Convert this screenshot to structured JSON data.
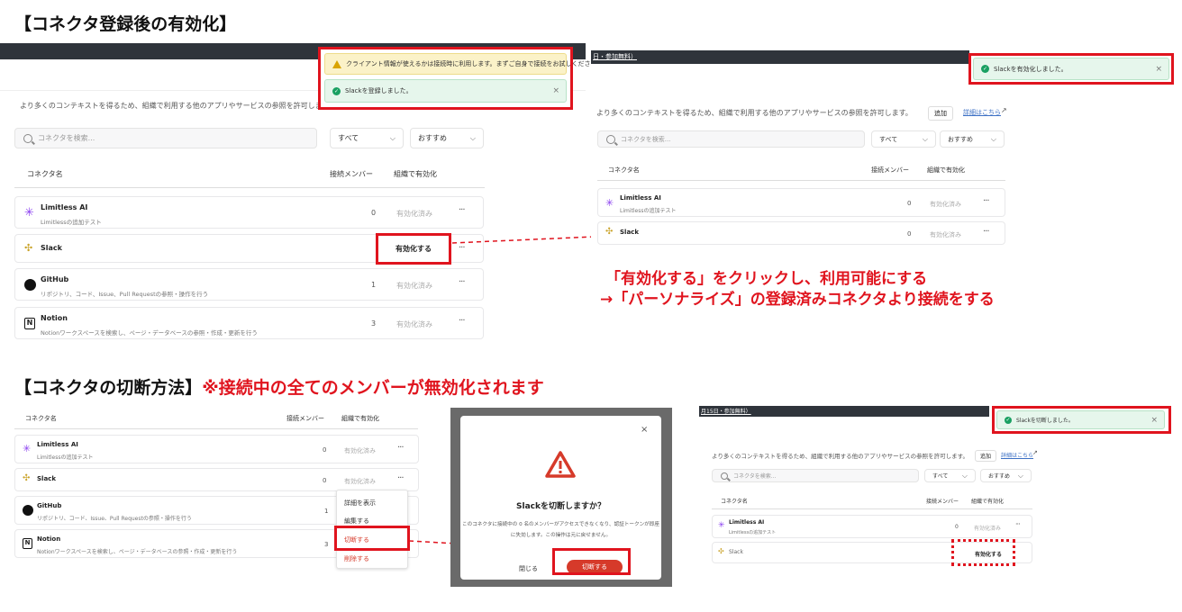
{
  "titles": {
    "section1": "【コネクタ登録後の有効化】",
    "section2_main": "【コネクタの切断方法】",
    "section2_warn": "※接続中の全てのメンバーが無効化されます"
  },
  "annotation": {
    "line1": "「有効化する」をクリックし、利用可能にする",
    "line2": "→「パーソナライズ」の登録済みコネクタより接続をする"
  },
  "common": {
    "description": "より多くのコンテキストを得るため、組織で利用する他のアプリやサービスの参照を許可します。",
    "search_placeholder": "コネクタを検索...",
    "filter_all": "すべて",
    "filter_recommended": "おすすめ",
    "col_name": "コネクタ名",
    "col_members": "接続メンバー",
    "col_org": "組織で有効化",
    "add_label": "追加",
    "details_link": "詳細はこちら",
    "enabled_label": "有効化済み",
    "enable_button": "有効化する",
    "banner_text_right": "日・参加無料）",
    "banner_text_bottom": "月15日・参加無料）",
    "connectors": {
      "limitless": {
        "name": "Limitless AI",
        "desc": "Limitlessの追加テスト",
        "count": "0"
      },
      "slack": {
        "name": "Slack",
        "count": "0"
      },
      "github": {
        "name": "GitHub",
        "desc": "リポジトリ、コード、Issue、Pull Requestの参照・操作を行う",
        "count": "1"
      },
      "notion": {
        "name": "Notion",
        "desc": "Notionワークスペースを検索し、ページ・データベースの参照・作成・更新を行う",
        "count": "3"
      }
    }
  },
  "toasts": {
    "warning": "クライアント情報が使えるかは接続時に利用します。まずご自身で接続をお試しください。",
    "slack_registered": "Slackを登録しました。",
    "slack_enabled": "Slackを有効化しました。",
    "slack_disconnected": "Slackを切断しました。",
    "close": "×"
  },
  "context_menu": {
    "details": "詳細を表示",
    "edit": "編集する",
    "disconnect": "切断する",
    "delete": "削除する"
  },
  "modal": {
    "title": "Slackを切断しますか？",
    "body_line1": "このコネクタに接続中の 0 名のメンバーがアクセスできなくなり、認証トークンが即座",
    "body_line2": "に失効します。この操作は元に戻せません。",
    "cancel": "閉じる",
    "confirm": "切断する",
    "close": "×"
  },
  "colors": {
    "accent_red": "#e0141e",
    "success_green": "#1aa062",
    "warning_yellow": "#fbf2c8",
    "danger_button": "#d63a2a"
  }
}
